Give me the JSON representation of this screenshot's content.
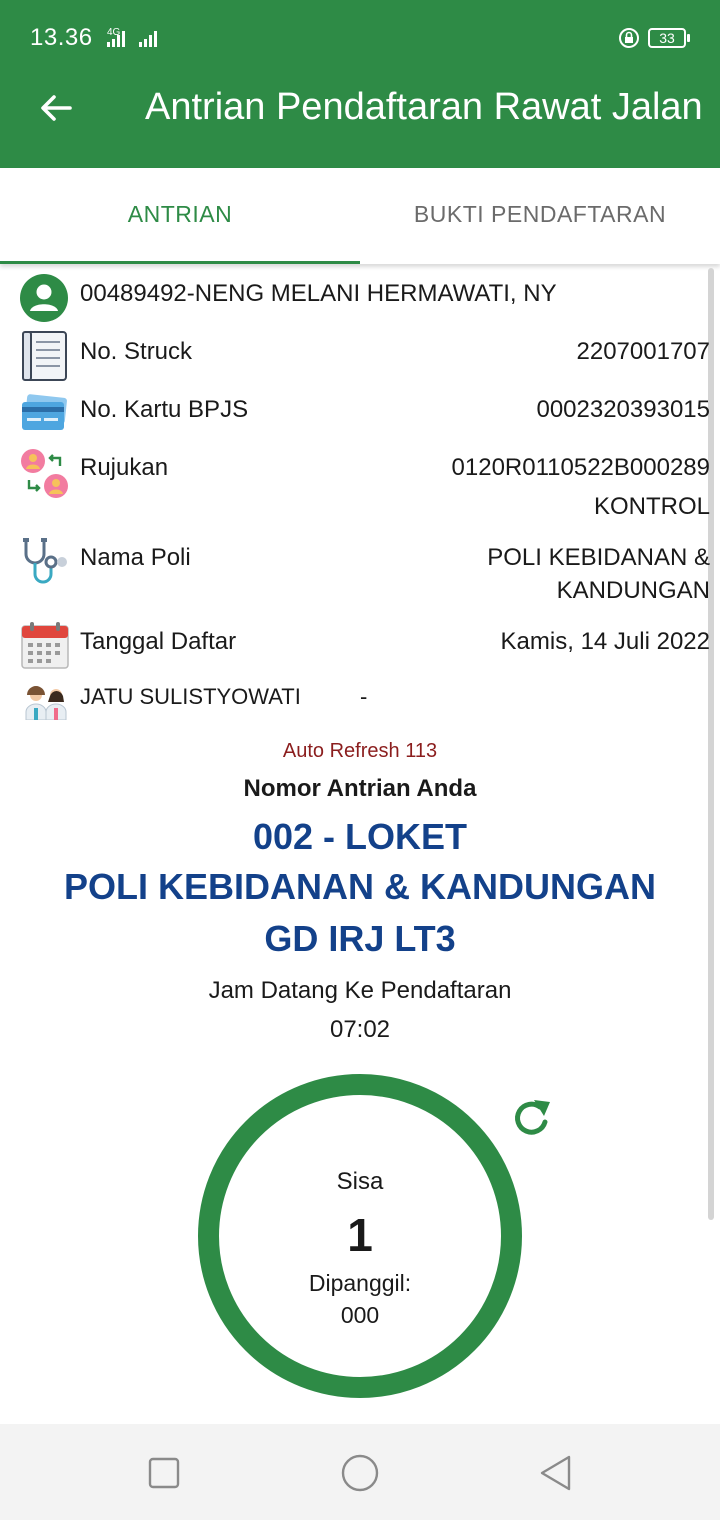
{
  "status_bar": {
    "time": "13.36",
    "network": "4G",
    "battery": "33"
  },
  "app_bar": {
    "title": "Antrian Pendaftaran Rawat Jalan"
  },
  "tabs": [
    {
      "label": "ANTRIAN",
      "active": true
    },
    {
      "label": "BUKTI PENDAFTARAN",
      "active": false
    }
  ],
  "patient": {
    "name": "00489492-NENG MELANI HERMAWATI, NY"
  },
  "info_rows": {
    "struck": {
      "label": "No. Struck",
      "value": "2207001707"
    },
    "bpjs": {
      "label": "No. Kartu BPJS",
      "value": "0002320393015"
    },
    "rujukan": {
      "label": "Rujukan",
      "value": "0120R0110522B000289",
      "value2": "KONTROL"
    },
    "poli": {
      "label": "Nama Poli",
      "value": "POLI KEBIDANAN &",
      "value2": "KANDUNGAN"
    },
    "tanggal": {
      "label": "Tanggal Daftar",
      "value": "Kamis, 14 Juli 2022"
    },
    "dokter": {
      "label": "JATU SULISTYOWATI",
      "value": "-"
    }
  },
  "queue": {
    "auto_refresh": "Auto Refresh 113",
    "heading": "Nomor Antrian Anda",
    "line1": "002 - LOKET",
    "line2": "POLI KEBIDANAN & KANDUNGAN",
    "line3": "GD IRJ LT3",
    "arrival_label": "Jam Datang Ke Pendaftaran",
    "arrival_time": "07:02",
    "remaining_label": "Sisa",
    "remaining_value": "1",
    "called_label": "Dipanggil:",
    "called_value": "000"
  },
  "colors": {
    "primary": "#2e8b46",
    "queue_text": "#13418a",
    "refresh_text": "#8b1e1e"
  },
  "icons": {
    "back": "arrow-left-icon",
    "patient": "user-circle-icon",
    "struck": "receipt-icon",
    "bpjs": "card-icon",
    "rujukan": "referral-icon",
    "poli": "stethoscope-icon",
    "tanggal": "calendar-icon",
    "dokter": "doctors-icon",
    "refresh": "refresh-icon",
    "nav_recent": "square-icon",
    "nav_home": "circle-icon",
    "nav_back": "triangle-back-icon"
  }
}
